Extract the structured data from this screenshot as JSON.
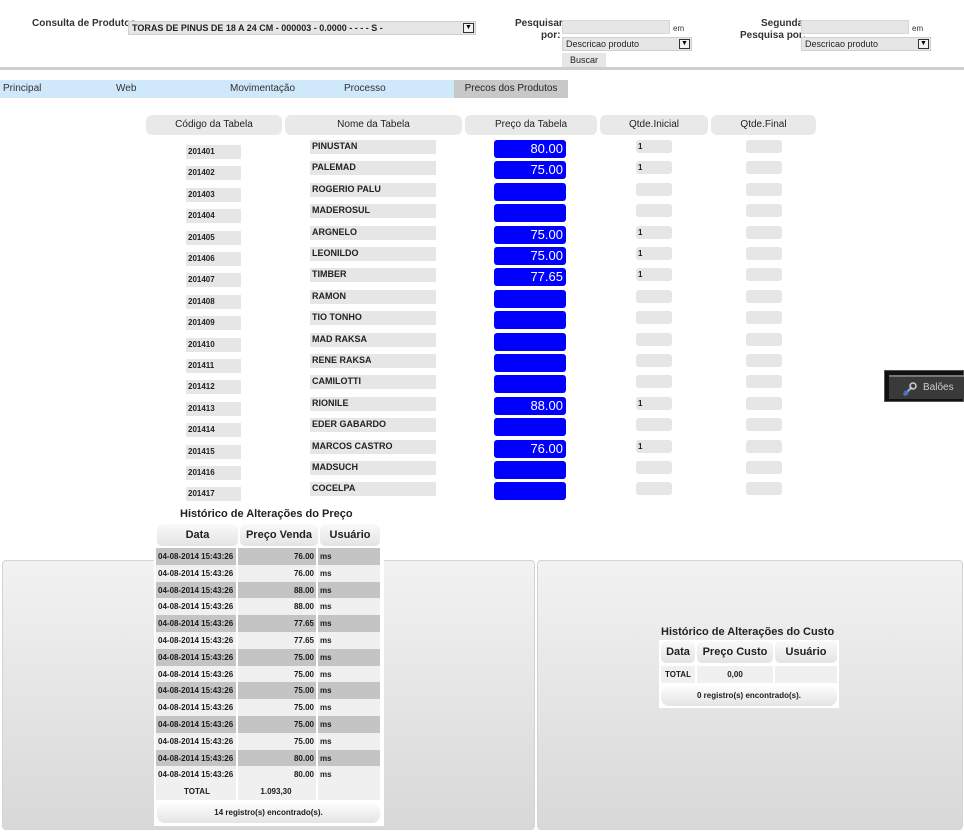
{
  "search": {
    "product_label": "Consulta de Produtos",
    "product_value": "TORAS DE PINUS DE 18 A 24 CM - 000003 - 0.0000 - - - - S -",
    "pesquisar_label1": "Pesquisar",
    "pesquisar_label2": "por:",
    "em1": "em",
    "field1_value": "Descricao produto",
    "buscar_label": "Buscar",
    "segunda_label1": "Segunda",
    "segunda_label2": "Pesquisa por:",
    "em2": "em",
    "field2_value": "Descricao produto"
  },
  "tabs": [
    "Principal",
    "Web",
    "Movimentação",
    "Processo",
    "Precos dos Produtos"
  ],
  "columns": [
    "Código da Tabela",
    "Nome da Tabela",
    "Preço da Tabela",
    "Qtde.Inicial",
    "Qtde.Final"
  ],
  "rows": [
    {
      "code": "201401",
      "name": "PINUSTAN",
      "price": "80.00",
      "qi": "1",
      "qf": ""
    },
    {
      "code": "201402",
      "name": "PALEMAD",
      "price": "75.00",
      "qi": "1",
      "qf": ""
    },
    {
      "code": "201403",
      "name": "ROGERIO PALU",
      "price": "",
      "qi": "",
      "qf": ""
    },
    {
      "code": "201404",
      "name": "MADEROSUL",
      "price": "",
      "qi": "",
      "qf": ""
    },
    {
      "code": "201405",
      "name": "ARGNELO",
      "price": "75.00",
      "qi": "1",
      "qf": ""
    },
    {
      "code": "201406",
      "name": "LEONILDO",
      "price": "75.00",
      "qi": "1",
      "qf": ""
    },
    {
      "code": "201407",
      "name": "TIMBER",
      "price": "77.65",
      "qi": "1",
      "qf": ""
    },
    {
      "code": "201408",
      "name": "RAMON",
      "price": "",
      "qi": "",
      "qf": ""
    },
    {
      "code": "201409",
      "name": "TIO TONHO",
      "price": "",
      "qi": "",
      "qf": ""
    },
    {
      "code": "201410",
      "name": "MAD RAKSA",
      "price": "",
      "qi": "",
      "qf": ""
    },
    {
      "code": "201411",
      "name": "RENE RAKSA",
      "price": "",
      "qi": "",
      "qf": ""
    },
    {
      "code": "201412",
      "name": "CAMILOTTI",
      "price": "",
      "qi": "",
      "qf": ""
    },
    {
      "code": "201413",
      "name": "RIONILE",
      "price": "88.00",
      "qi": "1",
      "qf": ""
    },
    {
      "code": "201414",
      "name": "EDER GABARDO",
      "price": "",
      "qi": "",
      "qf": ""
    },
    {
      "code": "201415",
      "name": "MARCOS CASTRO",
      "price": "76.00",
      "qi": "1",
      "qf": ""
    },
    {
      "code": "201416",
      "name": "MADSUCH",
      "price": "",
      "qi": "",
      "qf": ""
    },
    {
      "code": "201417",
      "name": "COCELPA",
      "price": "",
      "qi": "",
      "qf": ""
    }
  ],
  "price_history": {
    "title": "Histórico de Alterações do Preço",
    "headers": [
      "Data",
      "Preço Venda",
      "Usuário"
    ],
    "rows": [
      {
        "date": "04-08-2014 15:43:26",
        "value": "76.00",
        "user": "ms"
      },
      {
        "date": "04-08-2014 15:43:26",
        "value": "76.00",
        "user": "ms"
      },
      {
        "date": "04-08-2014 15:43:26",
        "value": "88.00",
        "user": "ms"
      },
      {
        "date": "04-08-2014 15:43:26",
        "value": "88.00",
        "user": "ms"
      },
      {
        "date": "04-08-2014 15:43:26",
        "value": "77.65",
        "user": "ms"
      },
      {
        "date": "04-08-2014 15:43:26",
        "value": "77.65",
        "user": "ms"
      },
      {
        "date": "04-08-2014 15:43:26",
        "value": "75.00",
        "user": "ms"
      },
      {
        "date": "04-08-2014 15:43:26",
        "value": "75.00",
        "user": "ms"
      },
      {
        "date": "04-08-2014 15:43:26",
        "value": "75.00",
        "user": "ms"
      },
      {
        "date": "04-08-2014 15:43:26",
        "value": "75.00",
        "user": "ms"
      },
      {
        "date": "04-08-2014 15:43:26",
        "value": "75.00",
        "user": "ms"
      },
      {
        "date": "04-08-2014 15:43:26",
        "value": "75.00",
        "user": "ms"
      },
      {
        "date": "04-08-2014 15:43:26",
        "value": "80.00",
        "user": "ms"
      },
      {
        "date": "04-08-2014 15:43:26",
        "value": "80.00",
        "user": "ms"
      }
    ],
    "total_label": "TOTAL",
    "total_value": "1.093,30",
    "footer": "14 registro(s) encontrado(s)."
  },
  "cost_history": {
    "title": "Histórico de Alterações do Custo",
    "headers": [
      "Data",
      "Preço Custo",
      "Usuário"
    ],
    "total_label": "TOTAL",
    "total_value": "0,00",
    "footer": "0 registro(s) encontrado(s)."
  },
  "balloon_label": "Balões",
  "colors": {
    "price_bg": "#0000ff",
    "tab_bg": "#cfe8fa",
    "tab_active": "#c8c8c8"
  }
}
